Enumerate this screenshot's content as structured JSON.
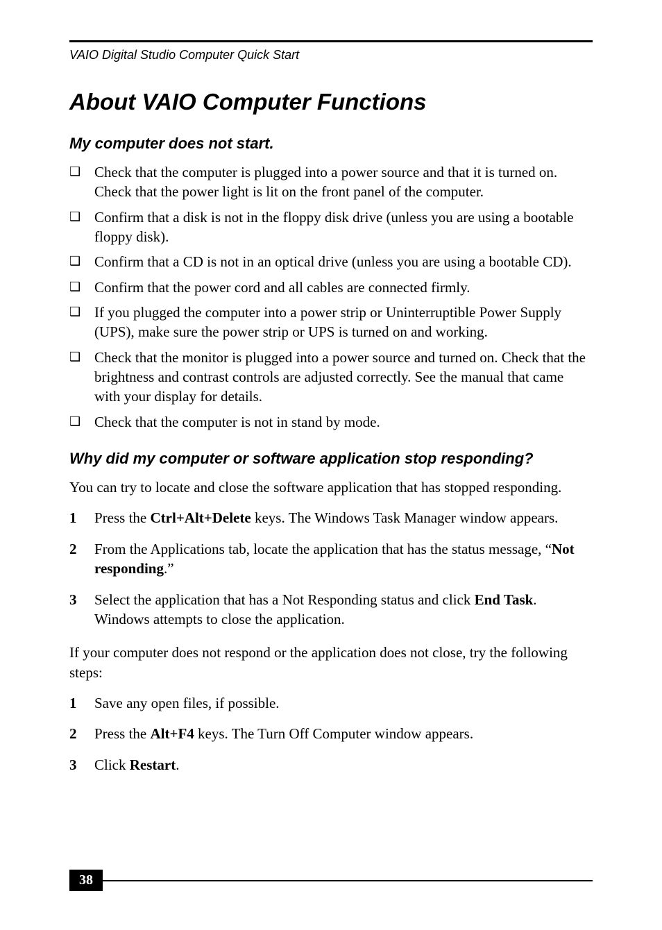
{
  "running_header": "VAIO Digital Studio Computer Quick Start",
  "title": "About VAIO Computer Functions",
  "section1": {
    "heading": "My computer does not start.",
    "bullets": [
      "Check that the computer is plugged into a power source and that it is turned on. Check that the power light is lit on the front panel of the computer.",
      "Confirm that a disk is not in the floppy disk drive (unless you are using a bootable floppy disk).",
      "Confirm that a CD is not in an optical drive (unless you are using a bootable CD).",
      "Confirm that the power cord and all cables are connected firmly.",
      "If you plugged the computer into a power strip or Uninterruptible Power Supply (UPS), make sure the power strip or UPS is turned on and working.",
      "Check that the monitor is plugged into a power source and turned on. Check that the brightness and contrast controls are adjusted correctly. See the manual that came with your display for details.",
      "Check that the computer is not in stand by mode."
    ]
  },
  "section2": {
    "heading": "Why did my computer or software application stop responding?",
    "intro": "You can try to locate and close the software application that has stopped responding.",
    "steps_a": [
      {
        "num": "1",
        "pre": "Press the ",
        "bold": "Ctrl+Alt+Delete",
        "post": " keys. The Windows Task Manager window appears."
      },
      {
        "num": "2",
        "pre": "From the Applications tab, locate the application that has the status message, “",
        "bold": "Not responding",
        "post": ".”"
      },
      {
        "num": "3",
        "pre": "Select the application that has a Not Responding status and click ",
        "bold": "End Task",
        "post": ". Windows attempts to close the application."
      }
    ],
    "bridge": "If your computer does not respond or the application does not close, try the following steps:",
    "steps_b": [
      {
        "num": "1",
        "pre": "Save any open files, if possible.",
        "bold": "",
        "post": ""
      },
      {
        "num": "2",
        "pre": "Press the ",
        "bold": "Alt+F4",
        "post": " keys. The Turn Off Computer window appears."
      },
      {
        "num": "3",
        "pre": "Click ",
        "bold": "Restart",
        "post": "."
      }
    ]
  },
  "page_number": "38",
  "bullet_glyph": "❑"
}
